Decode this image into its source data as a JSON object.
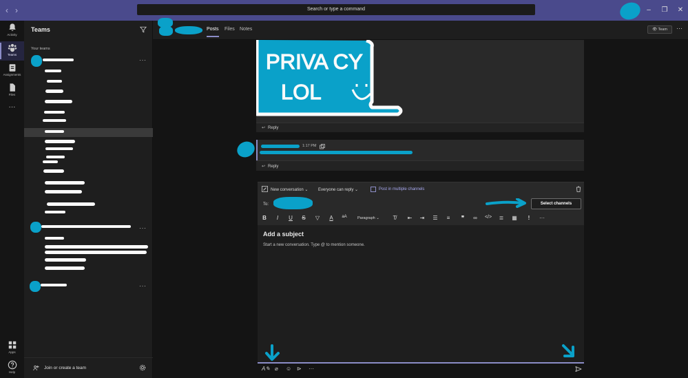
{
  "titlebar": {
    "back_icon": "chevron-left-icon",
    "forward_icon": "chevron-right-icon",
    "search_placeholder": "Search or type a command",
    "minimize": "–",
    "restore": "❐",
    "close": "✕"
  },
  "rail": {
    "items": [
      {
        "label": "Activity",
        "icon": "bell-icon"
      },
      {
        "label": "Teams",
        "icon": "teams-icon"
      },
      {
        "label": "Assignments",
        "icon": "assignments-icon"
      },
      {
        "label": "Files",
        "icon": "files-icon"
      },
      {
        "label": "···",
        "icon": "more-icon"
      }
    ],
    "bottom": [
      {
        "label": "Apps",
        "icon": "apps-icon"
      },
      {
        "label": "Help",
        "icon": "help-icon"
      }
    ]
  },
  "teams_panel": {
    "title": "Teams",
    "section_label": "Your teams",
    "more": "···",
    "join_label": "Join or create a team"
  },
  "channel": {
    "tabs": [
      "Posts",
      "Files",
      "Notes"
    ],
    "team_button": "Team",
    "more": "···"
  },
  "image_annotation": {
    "line1": "PRIVA CY",
    "line2": "LOL"
  },
  "messages": [
    {
      "reply": "Reply"
    },
    {
      "time": "1:17 PM",
      "reply": "Reply"
    }
  ],
  "compose": {
    "new_conversation": "New conversation",
    "reply_setting": "Everyone can reply",
    "post_multiple": "Post in multiple channels",
    "to_label": "To:",
    "select_channels": "Select channels",
    "paragraph": "Paragraph",
    "subject_placeholder": "Add a subject",
    "body_placeholder": "Start a new conversation. Type @ to mention someone."
  },
  "colors": {
    "accent": "#8b8cc7",
    "titlebar": "#4a4a8c",
    "redaction": "#0aa1c9",
    "scribble": "#fafafa"
  }
}
